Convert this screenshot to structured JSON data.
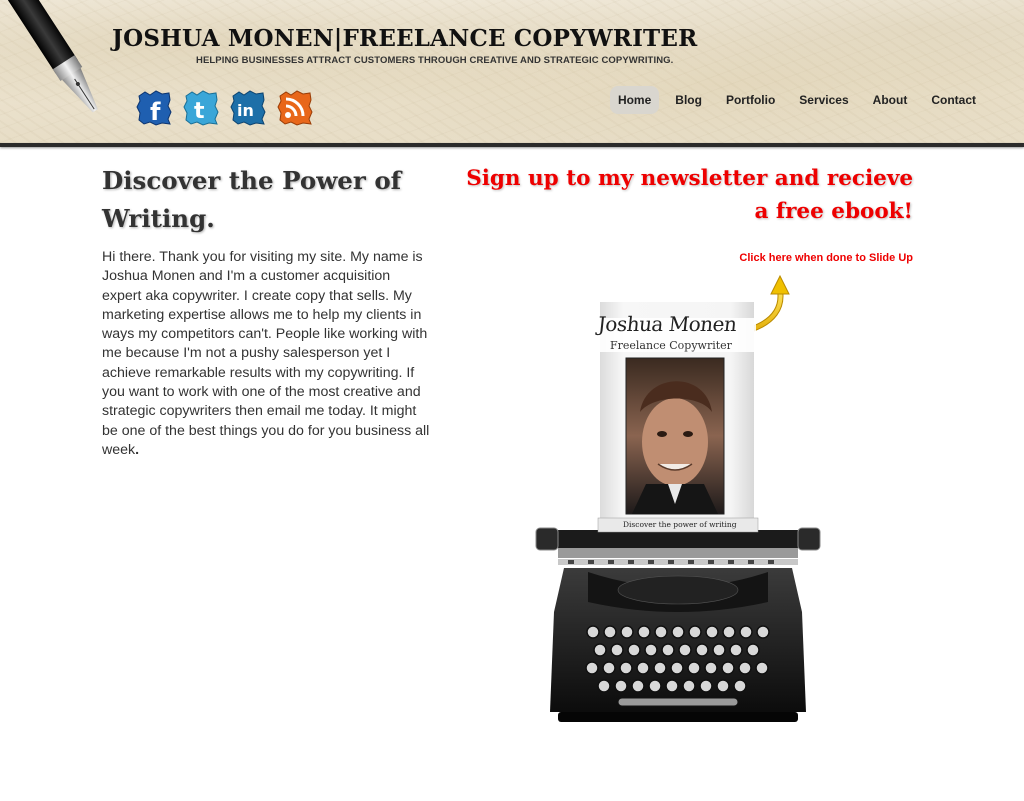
{
  "header": {
    "site_title": "JOSHUA MONEN|FREELANCE COPYWRITER",
    "tagline": "HELPING BUSINESSES ATTRACT CUSTOMERS THROUGH CREATIVE AND STRATEGIC COPYWRITING.",
    "social": [
      {
        "name": "facebook-icon",
        "glyph": "f",
        "color": "#1f5fb0"
      },
      {
        "name": "twitter-icon",
        "glyph": "t",
        "color": "#3aa6d8"
      },
      {
        "name": "linkedin-icon",
        "glyph": "in",
        "color": "#1d6fa8"
      },
      {
        "name": "rss-icon",
        "glyph": "rss",
        "color": "#e8671a"
      }
    ]
  },
  "nav": {
    "items": [
      {
        "label": "Home",
        "active": true
      },
      {
        "label": "Blog",
        "active": false
      },
      {
        "label": "Portfolio",
        "active": false
      },
      {
        "label": "Services",
        "active": false
      },
      {
        "label": "About",
        "active": false
      },
      {
        "label": "Contact",
        "active": false
      }
    ]
  },
  "intro": {
    "heading": "Discover the Power of Writing.",
    "body": "Hi there. Thank you for visiting my site. My name is Joshua Monen and I'm a customer acquisition expert aka copywriter. I create copy that sells. My marketing expertise allows me to help my clients in ways my competitors can't. People like working with me because I'm not a pushy salesperson yet I achieve remarkable results with my copywriting. If you want to work with one of the most creative and strategic copywriters then email me today. It might be one of the best things you do for you business all week",
    "body_end": "."
  },
  "newsletter": {
    "heading": "Sign up to my newsletter and recieve a free ebook!",
    "slide_up_link": "Click here when done to Slide Up"
  },
  "typewriter_image": {
    "brand_name": "Joshua Monen",
    "brand_role": "Freelance Copywriter",
    "paper_caption": "Discover the power of writing"
  },
  "colors": {
    "accent_red": "#ee0000",
    "header_rule": "#2b2b2b",
    "active_nav_bg": "#d9d6cf",
    "body_text": "#333333"
  }
}
